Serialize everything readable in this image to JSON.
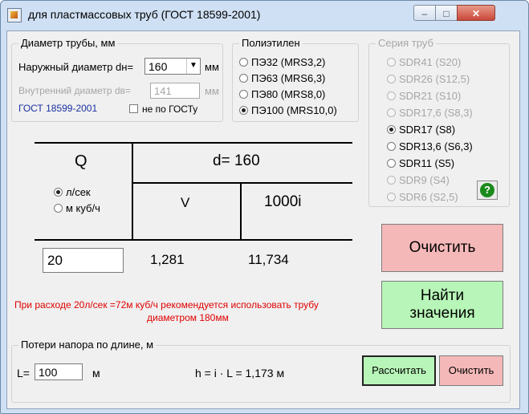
{
  "window": {
    "title": "для пластмассовых труб (ГОСТ 18599-2001)"
  },
  "diameter_group": {
    "legend": "Диаметр трубы, мм",
    "outer_label": "Наружный диаметр dн=",
    "outer_value": "160",
    "outer_unit": "мм",
    "inner_label": "Внутренний диаметр dв=",
    "inner_value": "141",
    "inner_unit": "мм",
    "standard": "ГОСТ 18599-2001",
    "non_standard_label": "не по ГОСТу"
  },
  "polyethylene_group": {
    "legend": "Полиэтилен",
    "options": [
      "ПЭ32 (MRS3,2)",
      "ПЭ63 (MRS6,3)",
      "ПЭ80 (MRS8,0)",
      "ПЭ100 (MRS10,0)"
    ],
    "selected": "ПЭ100 (MRS10,0)"
  },
  "series_group": {
    "legend": "Серия труб",
    "options": [
      "SDR41 (S20)",
      "SDR26 (S12,5)",
      "SDR21 (S10)",
      "SDR17,6 (S8,3)",
      "SDR17 (S8)",
      "SDR13,6 (S6,3)",
      "SDR11 (S5)",
      "SDR9 (S4)",
      "SDR6 (S2,5)"
    ],
    "selected": "SDR17 (S8)",
    "help_icon": "question-mark-icon",
    "help_color": "#1a8a1a"
  },
  "table": {
    "q_header": "Q",
    "flow_units": [
      "л/сек",
      "м куб/ч"
    ],
    "selected_unit": "л/сек",
    "d_header": "d= 160",
    "v_header": "V",
    "i_header": "1000i",
    "q_value": "20",
    "v_value": "1,281",
    "i_value": "11,734"
  },
  "recommendation": {
    "line1": "При расходе 20л/сек =72м куб/ч рекомендуется использовать трубу",
    "line2": "диаметром 180мм",
    "color": "#e00000"
  },
  "buttons": {
    "clear_main": "Очистить",
    "find_line1": "Найти",
    "find_line2": "значения",
    "clear_color": "#f5b8b8",
    "find_color": "#b8f5b8"
  },
  "head_loss": {
    "legend": "Потери напора по длине, м",
    "l_label": "L=",
    "l_value": "100",
    "l_unit": "м",
    "formula": "h = i · L = 1,173 м",
    "calc_button": "Рассчитать",
    "clear_button": "Очистить"
  }
}
